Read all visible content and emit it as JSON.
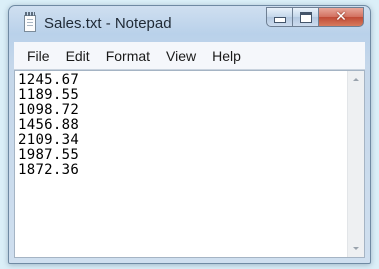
{
  "window": {
    "title": "Sales.txt - Notepad",
    "controls": {
      "minimize": "minimize",
      "maximize": "maximize",
      "close": "✕"
    }
  },
  "menu": [
    "File",
    "Edit",
    "Format",
    "View",
    "Help"
  ],
  "document": {
    "lines": [
      "1245.67",
      "1189.55",
      "1098.72",
      "1456.88",
      "2109.34",
      "1987.55",
      "1872.36"
    ]
  },
  "icons": {
    "app": "notepad-icon",
    "scroll_up": "scroll-up-arrow-icon",
    "scroll_down": "scroll-down-arrow-icon"
  },
  "colors": {
    "background": "#dbeff8",
    "close_button": "#c94f3a",
    "editor_background": "#ffffff"
  }
}
